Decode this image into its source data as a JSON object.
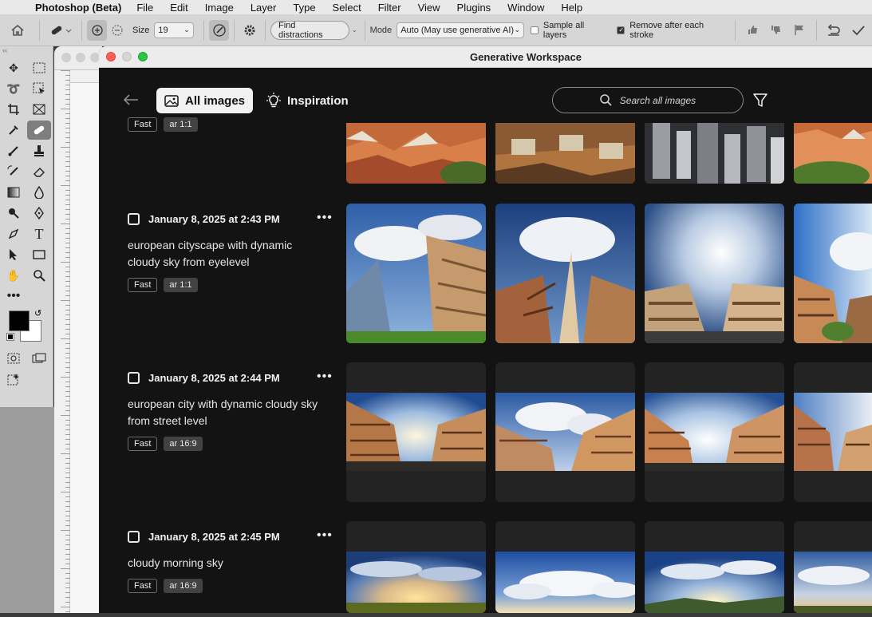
{
  "menubar": {
    "app_name": "Photoshop (Beta)",
    "items": [
      "File",
      "Edit",
      "Image",
      "Layer",
      "Type",
      "Select",
      "Filter",
      "View",
      "Plugins",
      "Window",
      "Help"
    ]
  },
  "options_bar": {
    "size_label": "Size",
    "size_value": "19",
    "find_distractions_label": "Find distractions",
    "mode_label": "Mode",
    "mode_value": "Auto (May use generative AI)",
    "sample_all_layers_label": "Sample all layers",
    "sample_all_layers_checked": false,
    "remove_after_stroke_label": "Remove after each stroke",
    "remove_after_stroke_checked": true
  },
  "window": {
    "title": "Generative Workspace"
  },
  "nav": {
    "tab_all_images": "All images",
    "tab_inspiration": "Inspiration",
    "search_placeholder": "Search all images"
  },
  "top_partial": {
    "tags": [
      "Fast",
      "ar 1:1"
    ]
  },
  "generations": [
    {
      "date": "January 8, 2025 at 2:43 PM",
      "prompt": "european cityscape with dynamic cloudy sky from eyelevel",
      "tags": [
        "Fast",
        "ar 1:1"
      ]
    },
    {
      "date": "January 8, 2025 at 2:44 PM",
      "prompt": "european city with dynamic cloudy sky from street level",
      "tags": [
        "Fast",
        "ar 16:9"
      ]
    },
    {
      "date": "January 8, 2025 at 2:45 PM",
      "prompt": "cloudy morning sky",
      "tags": [
        "Fast",
        "ar 16:9"
      ]
    }
  ],
  "colors": {
    "workspace_bg": "#131313",
    "tile_bg": "#232323",
    "active_tab_bg": "#f2f2f2"
  }
}
